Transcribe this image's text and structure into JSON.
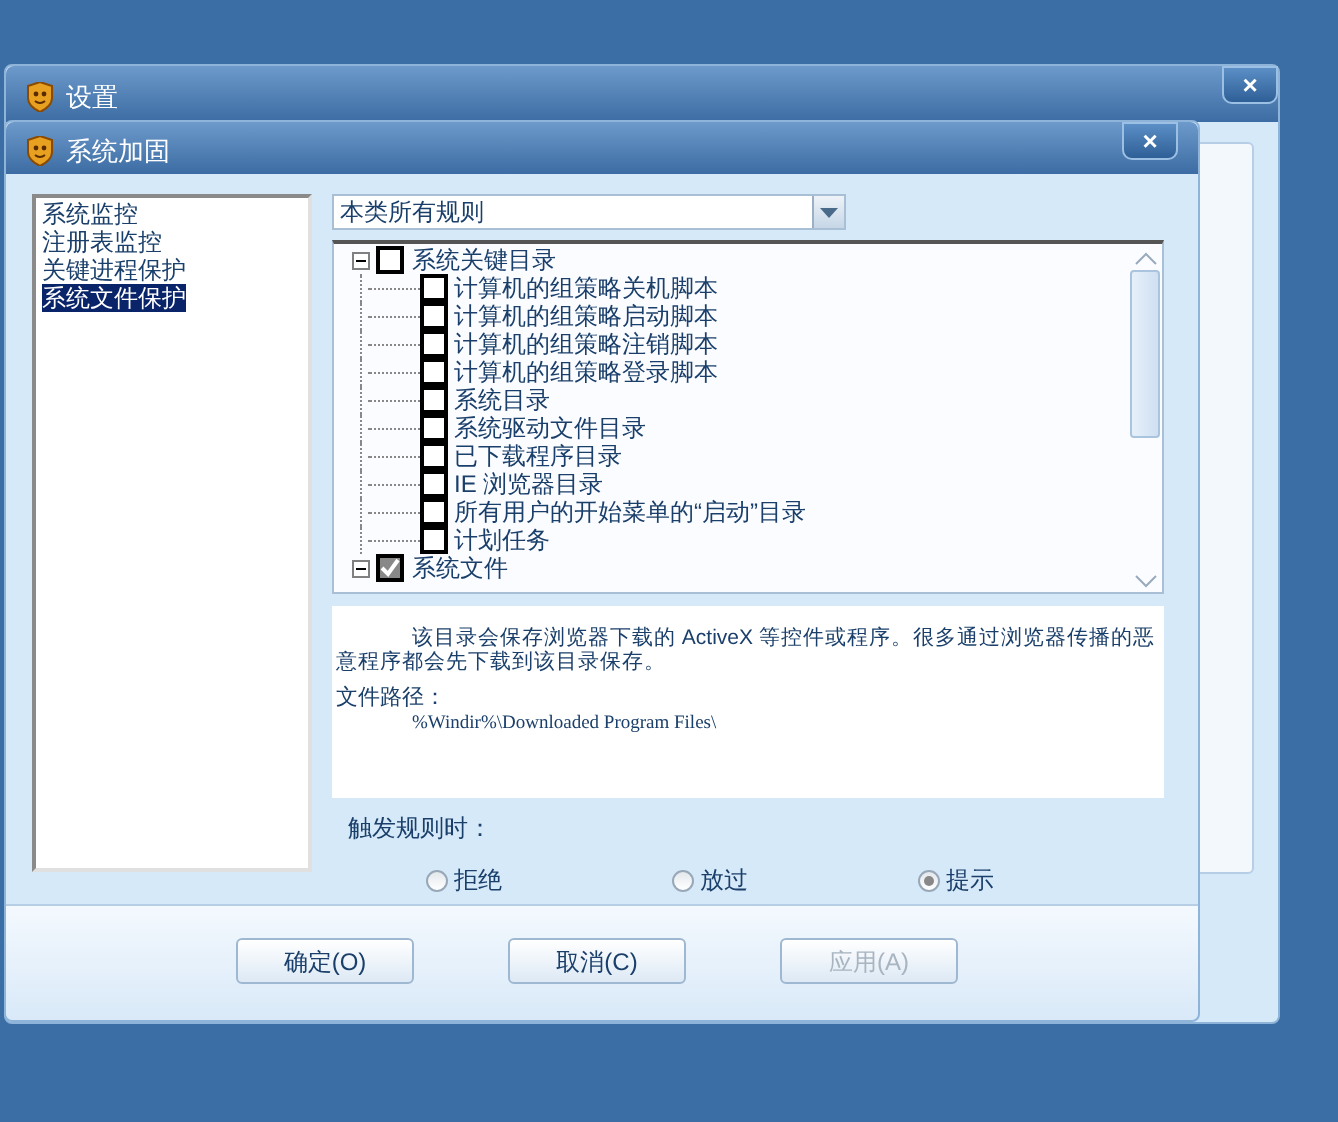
{
  "back_window": {
    "title": "设置",
    "close": "×"
  },
  "window": {
    "title": "系统加固",
    "close": "×"
  },
  "sidebar": {
    "items": [
      {
        "label": "系统监控",
        "selected": false
      },
      {
        "label": "注册表监控",
        "selected": false
      },
      {
        "label": "关键进程保护",
        "selected": false
      },
      {
        "label": "系统文件保护",
        "selected": true
      }
    ]
  },
  "filter": {
    "value": "本类所有规则"
  },
  "tree": [
    {
      "label": "系统关键目录",
      "expanded": true,
      "checked": false,
      "children": [
        {
          "label": "计算机的组策略关机脚本",
          "checked": false
        },
        {
          "label": "计算机的组策略启动脚本",
          "checked": false
        },
        {
          "label": "计算机的组策略注销脚本",
          "checked": false
        },
        {
          "label": "计算机的组策略登录脚本",
          "checked": false
        },
        {
          "label": "系统目录",
          "checked": false
        },
        {
          "label": "系统驱动文件目录",
          "checked": false
        },
        {
          "label": "已下载程序目录",
          "checked": false
        },
        {
          "label": "IE 浏览器目录",
          "checked": false
        },
        {
          "label": "所有用户的开始菜单的“启动”目录",
          "checked": false
        },
        {
          "label": "计划任务",
          "checked": false
        }
      ]
    },
    {
      "label": "系统文件",
      "expanded": true,
      "checked": true
    }
  ],
  "description": {
    "text": "该目录会保存浏览器下载的 ActiveX 等控件或程序。很多通过浏览器传播的恶意程序都会先下载到该目录保存。",
    "path_label": "文件路径：",
    "path": "%Windir%\\Downloaded Program Files\\"
  },
  "action": {
    "label": "触发规则时：",
    "options": [
      {
        "label": "拒绝",
        "selected": false
      },
      {
        "label": "放过",
        "selected": false
      },
      {
        "label": "提示",
        "selected": true
      }
    ]
  },
  "buttons": [
    {
      "label": "确定(O)",
      "disabled": false
    },
    {
      "label": "取消(C)",
      "disabled": false
    },
    {
      "label": "应用(A)",
      "disabled": true
    }
  ]
}
